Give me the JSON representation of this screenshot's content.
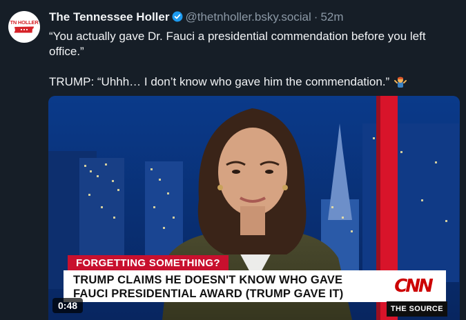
{
  "post": {
    "author_name": "The Tennessee Holler",
    "handle": "@thetnholler.bsky.social",
    "separator": "·",
    "time_ago": "52m",
    "avatar_logo_text": "TN HOLLER",
    "paragraph_1": "“You actually gave Dr. Fauci a presidential commendation before you left office.”",
    "paragraph_2": "TRUMP: “Uhhh… I don’t know who gave him the commendation.”",
    "emoji": "person-shrugging-emoji"
  },
  "video": {
    "duration": "0:48",
    "banner_kicker": "FORGETTING SOMETHING?",
    "banner_headline": "TRUMP CLAIMS HE DOESN'T KNOW WHO GAVE FAUCI PRESIDENTIAL AWARD (TRUMP GAVE IT)",
    "network_logo": "CNN",
    "show_name": "THE SOURCE"
  },
  "colors": {
    "background": "#161e27",
    "verified_blue": "#1d9bf0",
    "cnn_red": "#c8102e",
    "muted_text": "#8b98a5"
  }
}
